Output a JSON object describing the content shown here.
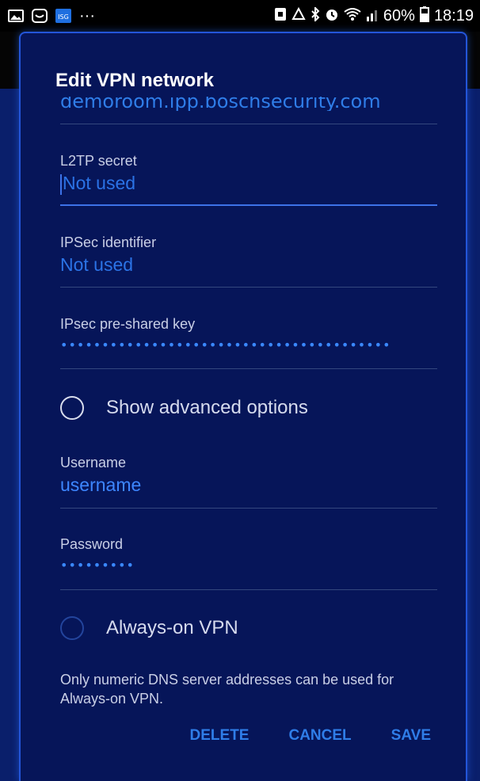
{
  "status_bar": {
    "battery": "60%",
    "time": "18:19",
    "notification_dots": "···",
    "isg_badge": "ISG"
  },
  "dialog": {
    "title": "Edit VPN network",
    "server_address_cut": "demoroom.ipp.boschsecurity.com",
    "fields": [
      {
        "label": "L2TP secret",
        "value": "Not used"
      },
      {
        "label": "IPSec identifier",
        "value": "Not used"
      },
      {
        "label": "IPsec pre-shared key",
        "value": "••••••••••••••••••••••••••••••••••••••••"
      }
    ],
    "show_advanced": "Show advanced options",
    "username": {
      "label": "Username",
      "value": "username"
    },
    "password": {
      "label": "Password",
      "value": "•••••••••"
    },
    "always_on": "Always-on VPN",
    "note": "Only numeric DNS server addresses can be used for Always-on VPN.",
    "buttons": {
      "delete": "DELETE",
      "cancel": "CANCEL",
      "save": "SAVE"
    }
  },
  "colors": {
    "accent": "#2f7de8",
    "dialog_bg": "#061559",
    "page_bg": "#0a1f6b"
  }
}
